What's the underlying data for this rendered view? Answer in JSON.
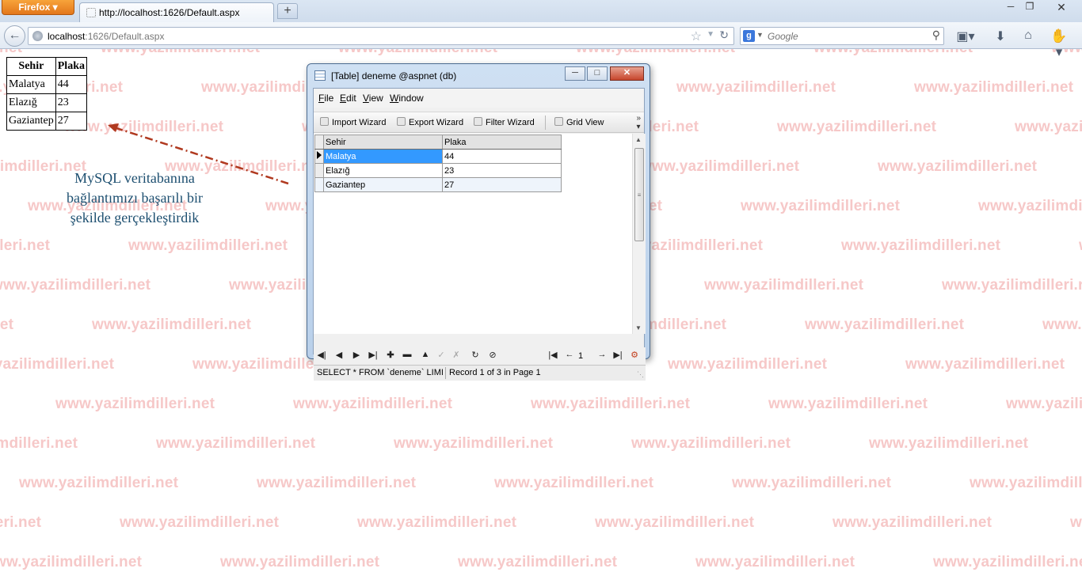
{
  "watermark": {
    "text": "www.yazilimdilleri.net"
  },
  "browser": {
    "app_button": "Firefox",
    "tab": {
      "title": "http://localhost:1626/Default.aspx"
    },
    "url": {
      "host": "localhost",
      "rest": ":1626/Default.aspx"
    },
    "search": {
      "engine_glyph": "g",
      "placeholder": "Google"
    }
  },
  "page": {
    "table": {
      "headers": [
        "Sehir",
        "Plaka"
      ],
      "rows": [
        [
          "Malatya",
          "44"
        ],
        [
          "Elazığ",
          "23"
        ],
        [
          "Gaziantep",
          "27"
        ]
      ]
    },
    "annotation": [
      "MySQL veritabanına",
      "bağlantımızı başarılı bir",
      "şekilde gerçekleştirdik"
    ]
  },
  "dialog": {
    "title": "[Table] deneme @aspnet (db)",
    "menu": [
      {
        "accel": "F",
        "rest": "ile"
      },
      {
        "accel": "E",
        "rest": "dit"
      },
      {
        "accel": "V",
        "rest": "iew"
      },
      {
        "accel": "W",
        "rest": "indow"
      }
    ],
    "toolbar": [
      "Import Wizard",
      "Export Wizard",
      "Filter Wizard",
      "Grid View"
    ],
    "grid": {
      "headers": [
        "Sehir",
        "Plaka"
      ],
      "rows": [
        [
          "Malatya",
          "44"
        ],
        [
          "Elazığ",
          "23"
        ],
        [
          "Gaziantep",
          "27"
        ]
      ]
    },
    "page_number": "1",
    "status": {
      "sql": "SELECT * FROM `deneme` LIMI",
      "record": "Record 1 of 3 in Page 1"
    }
  }
}
